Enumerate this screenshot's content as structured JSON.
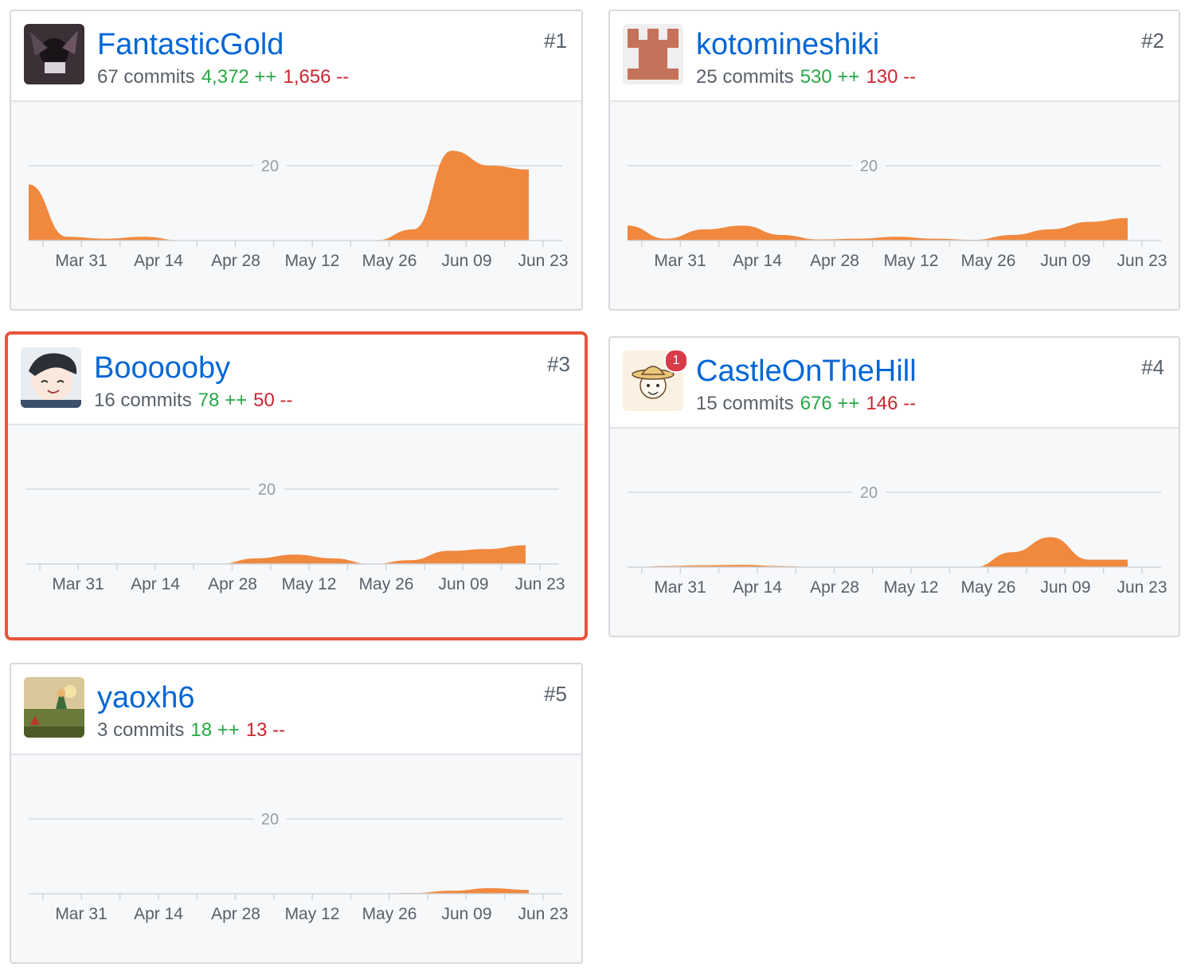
{
  "axis_ticks": [
    "Mar 31",
    "Apr 14",
    "Apr 28",
    "May 12",
    "May 26",
    "Jun 09",
    "Jun 23"
  ],
  "grid_label": "20",
  "colors": {
    "area": "#f0883e",
    "link": "#0366d6",
    "adds": "#28a745",
    "dels": "#cb2431",
    "highlight": "#e8543a"
  },
  "contributors": [
    {
      "rank": "#1",
      "username": "FantasticGold",
      "commits": "67 commits",
      "additions": "4,372 ++",
      "deletions": "1,656 --",
      "avatar": "dark-figure-avatar",
      "highlighted": false
    },
    {
      "rank": "#2",
      "username": "kotomineshiki",
      "commits": "25 commits",
      "additions": "530 ++",
      "deletions": "130 --",
      "avatar": "identicon-avatar",
      "highlighted": false
    },
    {
      "rank": "#3",
      "username": "Boooooby",
      "commits": "16 commits",
      "additions": "78 ++",
      "deletions": "50 --",
      "avatar": "cartoon-face-avatar",
      "highlighted": true
    },
    {
      "rank": "#4",
      "username": "CastleOnTheHill",
      "commits": "15 commits",
      "additions": "676 ++",
      "deletions": "146 --",
      "avatar": "straw-hat-avatar",
      "badge": "1",
      "highlighted": false
    },
    {
      "rank": "#5",
      "username": "yaoxh6",
      "commits": "3 commits",
      "additions": "18 ++",
      "deletions": "13 --",
      "avatar": "little-prince-avatar",
      "highlighted": false
    }
  ],
  "chart_data": [
    {
      "type": "area",
      "title": "FantasticGold",
      "x": [
        "Mar 24",
        "Mar 31",
        "Apr 7",
        "Apr 14",
        "Apr 21",
        "Apr 28",
        "May 5",
        "May 12",
        "May 19",
        "May 26",
        "Jun 2",
        "Jun 9",
        "Jun 16",
        "Jun 19"
      ],
      "values": [
        15,
        1,
        0.5,
        1,
        0,
        0,
        0,
        0,
        0,
        0,
        3,
        24,
        20,
        19
      ],
      "ylim": [
        0,
        25
      ],
      "gridline": 20
    },
    {
      "type": "area",
      "title": "kotomineshiki",
      "x": [
        "Mar 24",
        "Mar 31",
        "Apr 7",
        "Apr 14",
        "Apr 21",
        "Apr 28",
        "May 5",
        "May 12",
        "May 19",
        "May 26",
        "Jun 2",
        "Jun 9",
        "Jun 16",
        "Jun 19"
      ],
      "values": [
        4,
        0.5,
        3,
        4,
        1.5,
        0.3,
        0.5,
        1,
        0.5,
        0.2,
        1.5,
        3,
        5,
        6
      ],
      "ylim": [
        0,
        25
      ],
      "gridline": 20
    },
    {
      "type": "area",
      "title": "Boooooby",
      "x": [
        "Mar 24",
        "Mar 31",
        "Apr 7",
        "Apr 14",
        "Apr 21",
        "Apr 28",
        "May 5",
        "May 12",
        "May 19",
        "May 26",
        "Jun 2",
        "Jun 9",
        "Jun 16",
        "Jun 19"
      ],
      "values": [
        0,
        0,
        0,
        0,
        0,
        0,
        1.5,
        2.5,
        1.5,
        0,
        1,
        3.5,
        4,
        5
      ],
      "ylim": [
        0,
        25
      ],
      "gridline": 20
    },
    {
      "type": "area",
      "title": "CastleOnTheHill",
      "x": [
        "Mar 24",
        "Mar 31",
        "Apr 7",
        "Apr 14",
        "Apr 21",
        "Apr 28",
        "May 5",
        "May 12",
        "May 19",
        "May 26",
        "Jun 2",
        "Jun 9",
        "Jun 16",
        "Jun 19"
      ],
      "values": [
        0,
        0.3,
        0.5,
        0.6,
        0.3,
        0,
        0,
        0,
        0,
        0,
        4,
        8,
        2,
        2
      ],
      "ylim": [
        0,
        25
      ],
      "gridline": 20
    },
    {
      "type": "area",
      "title": "yaoxh6",
      "x": [
        "Mar 24",
        "Mar 31",
        "Apr 7",
        "Apr 14",
        "Apr 21",
        "Apr 28",
        "May 5",
        "May 12",
        "May 19",
        "May 26",
        "Jun 2",
        "Jun 9",
        "Jun 16",
        "Jun 19"
      ],
      "values": [
        0,
        0,
        0,
        0,
        0,
        0,
        0,
        0,
        0,
        0,
        0.2,
        0.8,
        1.5,
        1
      ],
      "ylim": [
        0,
        25
      ],
      "gridline": 20
    }
  ]
}
